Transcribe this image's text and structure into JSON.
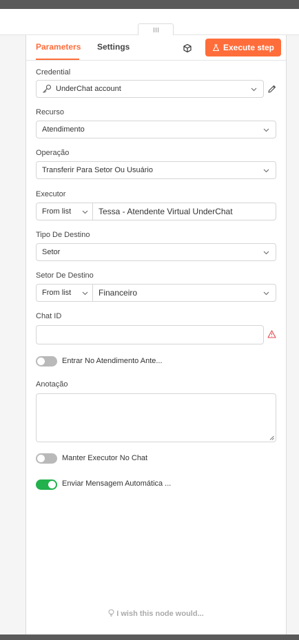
{
  "tabs": {
    "parameters": "Parameters",
    "settings": "Settings"
  },
  "execute": {
    "label": "Execute step",
    "color": "#ff6d3a"
  },
  "credential": {
    "label": "Credential",
    "value": "UnderChat account"
  },
  "recurso": {
    "label": "Recurso",
    "value": "Atendimento"
  },
  "operacao": {
    "label": "Operação",
    "value": "Transferir Para Setor Ou Usuário"
  },
  "executor": {
    "label": "Executor",
    "mode": "From list",
    "value": "Tessa - Atendente Virtual UnderChat"
  },
  "tipo_destino": {
    "label": "Tipo De Destino",
    "value": "Setor"
  },
  "setor_destino": {
    "label": "Setor De Destino",
    "mode": "From list",
    "value": "Financeiro"
  },
  "chat_id": {
    "label": "Chat ID",
    "value": ""
  },
  "toggles": {
    "entrar": {
      "label": "Entrar No Atendimento Ante...",
      "on": false
    },
    "manter": {
      "label": "Manter Executor No Chat",
      "on": false
    },
    "enviar": {
      "label": "Enviar Mensagem Automática ...",
      "on": true,
      "color": "#22b14c"
    }
  },
  "anotacao": {
    "label": "Anotação"
  },
  "footer": {
    "text": "I wish this node would..."
  }
}
